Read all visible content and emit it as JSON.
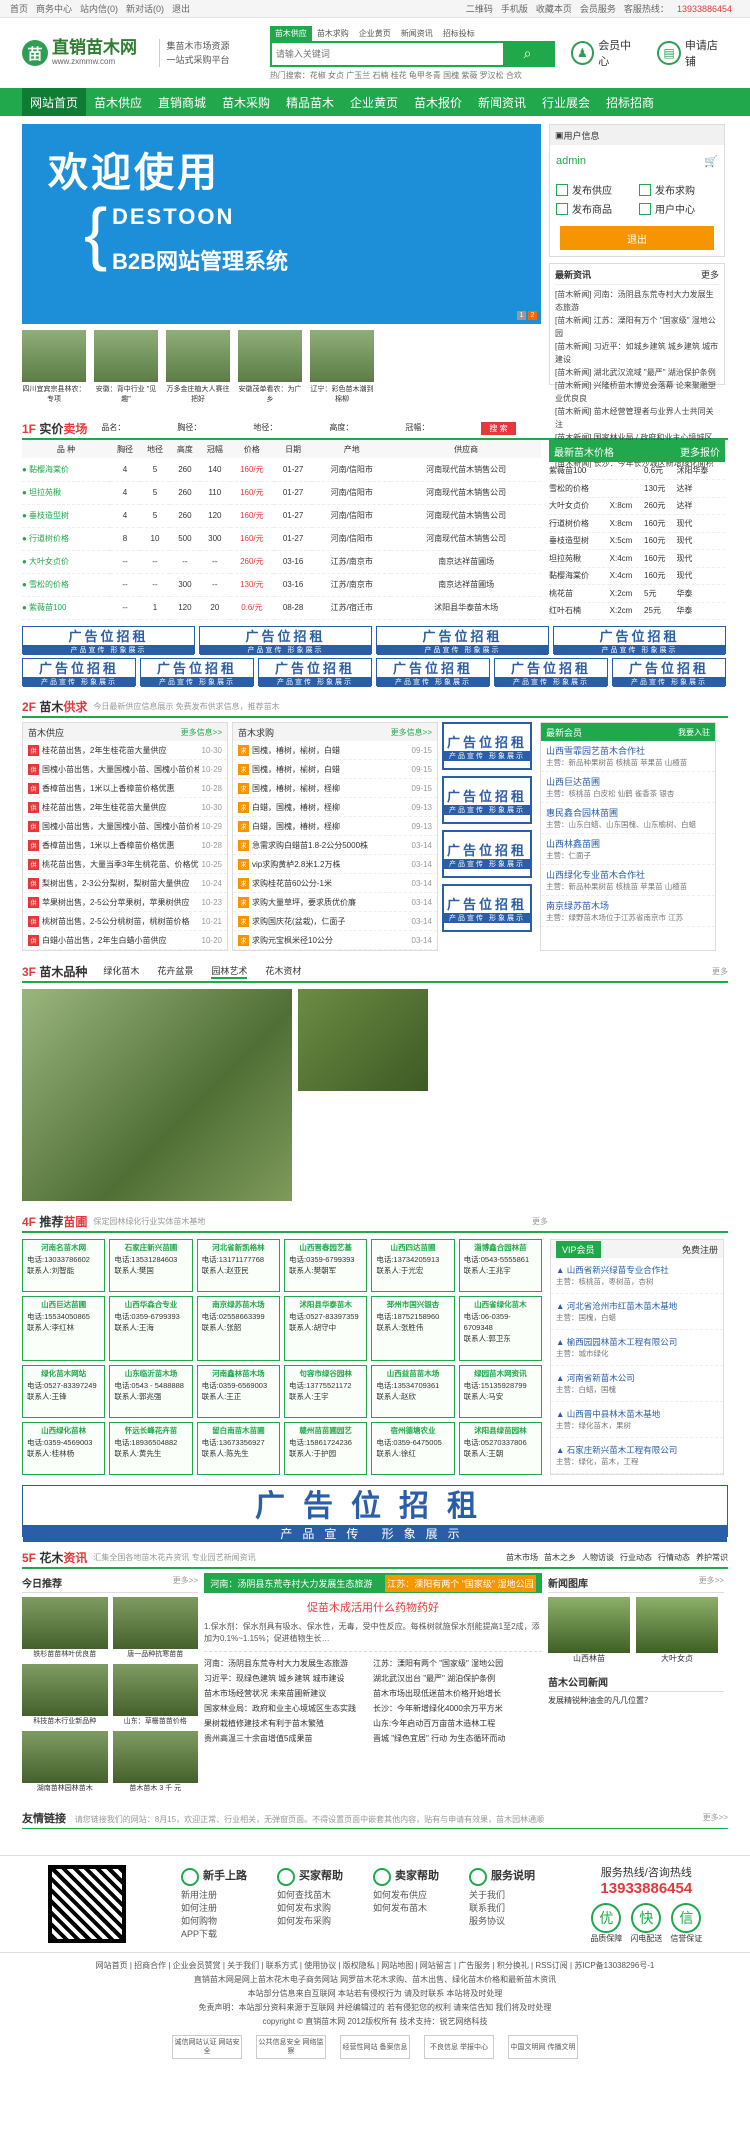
{
  "topbar": {
    "left": [
      "首页",
      "商务中心",
      "站内信(0)",
      "新对话(0)",
      "退出"
    ],
    "right": [
      "二维码",
      "手机版",
      "收藏本页",
      "会员服务",
      "客服热线：",
      "13933886454"
    ]
  },
  "header": {
    "logo": "直销苗木网",
    "url": "www.zxmmw.com",
    "slogan1": "集苗木市场资源",
    "slogan2": "一站式采购平台",
    "tabs": [
      "苗木供应",
      "苗木求购",
      "企业黄页",
      "新闻资讯",
      "招标投标"
    ],
    "search_placeholder": "请输入关键词",
    "hot": "热门搜索：花椒 女贞 广玉兰 石楠 桂花 龟甲冬青 国槐 紫薇 罗汉松 合欢",
    "member": "会员中心",
    "apply": "申请店铺"
  },
  "nav": [
    "网站首页",
    "苗木供应",
    "直销商城",
    "苗木采购",
    "精品苗木",
    "企业黄页",
    "苗木报价",
    "新闻资讯",
    "行业展会",
    "招标招商"
  ],
  "banner": {
    "h1": "欢迎使用",
    "h2": "DESTOON",
    "h3": "B2B网站管理系统",
    "pages": [
      "1",
      "2"
    ]
  },
  "user": {
    "header": "用户信息",
    "name": "admin",
    "ops": [
      "发布供应",
      "发布求购",
      "发布商品",
      "用户中心"
    ],
    "exit": "退出"
  },
  "latest": {
    "title": "最新资讯",
    "more": "更多",
    "items": [
      "[苗木新闻] 河南：汤阴县东荒寺村大力发展生态旅游",
      "[苗木新闻] 江苏：溧阳有万个 \"国家级\" 湿地公园",
      "[苗木新闻] 习近平：如城乡建筑 城乡建筑 城市建设",
      "[苗木新闻] 湖北武汉流域 \"最严\" 湖治保护条例",
      "[苗木新闻] 兴隆桥苗木博览会落幕 论来聚雕塑业优良良",
      "[苗木新闻] 苗木经营管理者与业界人士共同关注",
      "[苗木新闻] 国家林业局 / 政府和业主心境城区生态实践",
      "[苗木新闻] 长沙：今年长沙城区新增绿化面积"
    ]
  },
  "thumbs": [
    "四川宜宾宗县林农：专项",
    "安徽：背中行业 \"见趣\"",
    "万多金庄植大人赛往 把好",
    "安徽茂单看农：为广乡",
    "辽宁：彩色苗木潮到棉柳"
  ],
  "f1": {
    "num": "1F",
    "title": "实价",
    "title2": "卖场",
    "filters": [
      "品名：",
      "胸径：",
      "地径：",
      "高度：",
      "冠幅：",
      "搜 索"
    ],
    "cols": [
      "品 种",
      "胸径",
      "地径",
      "高度",
      "冠幅",
      "价格",
      "日期",
      "产地",
      "供应商"
    ],
    "rows": [
      [
        "黏樱海棠价",
        "4",
        "5",
        "260",
        "140",
        "160/元",
        "01-27",
        "河南/信阳市",
        "河南现代苗木销售公司"
      ],
      [
        "坦拉苑楸",
        "4",
        "5",
        "260",
        "110",
        "160/元",
        "01-27",
        "河南/信阳市",
        "河南现代苗木销售公司"
      ],
      [
        "垂枝造型树",
        "4",
        "5",
        "260",
        "120",
        "160/元",
        "01-27",
        "河南/信阳市",
        "河南现代苗木销售公司"
      ],
      [
        "行道树价格",
        "8",
        "10",
        "500",
        "300",
        "160/元",
        "01-27",
        "河南/信阳市",
        "河南现代苗木销售公司"
      ],
      [
        "大叶女贞价",
        "--",
        "--",
        "--",
        "--",
        "260/元",
        "03-16",
        "江苏/南京市",
        "南京达祥苗圃场"
      ],
      [
        "雪松的价格",
        "--",
        "--",
        "300",
        "--",
        "130/元",
        "03-16",
        "江苏/南京市",
        "南京达祥苗圃场"
      ],
      [
        "紫薇苗100",
        "--",
        "1",
        "120",
        "20",
        "0.6/元",
        "08-28",
        "江苏/宿迁市",
        "沭阳县华泰苗木场"
      ]
    ]
  },
  "price": {
    "title": "最新苗木价格",
    "more": "更多报价",
    "rows": [
      [
        "紫薇苗100",
        "",
        "0.6元",
        "沭阳华泰"
      ],
      [
        "雪松的价格",
        "",
        "130元",
        "达祥"
      ],
      [
        "大叶女贞价",
        "X:8cm",
        "260元",
        "达祥"
      ],
      [
        "行道树价格",
        "X:8cm",
        "160元",
        "现代"
      ],
      [
        "垂枝造型树",
        "X:5cm",
        "160元",
        "现代"
      ],
      [
        "坦拉苑楸",
        "X:4cm",
        "160元",
        "现代"
      ],
      [
        "黏樱海棠价",
        "X:4cm",
        "160元",
        "现代"
      ],
      [
        "桃花苗",
        "X:2cm",
        "5元",
        "华泰"
      ],
      [
        "红叶石楠",
        "X:2cm",
        "25元",
        "华泰"
      ]
    ]
  },
  "ad": {
    "a": "广告位招租",
    "b": "产品宣传 形象展示"
  },
  "f2": {
    "num": "2F",
    "title": "苗木",
    "title2": "供求",
    "sub": "今日最新供应信息展示 免费发布供求信息，推荐苗木",
    "supply": "苗木供应",
    "buy": "苗木求购",
    "more": "更多信息>>",
    "supply_items": [
      [
        "供",
        "桂花苗出售，2年生桂花苗大量供应",
        "10-30"
      ],
      [
        "供",
        "国槐小苗出售，大量国槐小苗、国槐小苗价格",
        "10-29"
      ],
      [
        "供",
        "香樟苗出售，1米以上香樟苗价格优惠",
        "10-28"
      ],
      [
        "供",
        "桂花苗出售，2年生桂花苗大量供应",
        "10-30"
      ],
      [
        "供",
        "国槐小苗出售，大量国槐小苗、国槐小苗价格",
        "10-29"
      ],
      [
        "供",
        "香樟苗出售，1米以上香樟苗价格优惠",
        "10-28"
      ],
      [
        "供",
        "桃花苗出售，大量当季3年生桃花苗、价格优惠",
        "10-25"
      ],
      [
        "供",
        "梨树出售，2-3公分梨树，梨树苗大量供应",
        "10-24"
      ],
      [
        "供",
        "苹果树出售，2-5公分苹果树，苹果树供应",
        "10-23"
      ],
      [
        "供",
        "桃树苗出售，2-5公分桃树苗，桃树苗价格",
        "10-21"
      ],
      [
        "供",
        "白蜡小苗出售，2年生白蜡小苗供应",
        "10-20"
      ]
    ],
    "buy_items": [
      [
        "求",
        "国槐，椿树，榆树，白蜡",
        "09-15"
      ],
      [
        "求",
        "国槐，椿树，榆树，白蜡",
        "09-15"
      ],
      [
        "求",
        "国槐，椿树，榆树，柽柳",
        "09-15"
      ],
      [
        "求",
        "白蜡，国槐，椿树，柽柳",
        "09-13"
      ],
      [
        "求",
        "白蜡，国槐，椿树，柽柳",
        "09-13"
      ],
      [
        "求",
        "急需求购白蜡苗1.8-2公分5000株",
        "03-14"
      ],
      [
        "求",
        "vip求购黄栌2.8米1.2万株",
        "03-14"
      ],
      [
        "求",
        "求购桂花苗60公分-1米",
        "03-14"
      ],
      [
        "求",
        "求购大量草坪，要求质优价廉",
        "03-14"
      ],
      [
        "求",
        "求购国庆花(盆栽)，仁面子",
        "03-14"
      ],
      [
        "求",
        "求购元宝枫米径10公分",
        "03-14"
      ]
    ],
    "co_title": "最新会员",
    "co_more": "我要入驻",
    "companies": [
      [
        "山西雪霏园艺苗木合作社",
        "主营：新品种果树苗 核桃苗 苹果苗 山楂苗"
      ],
      [
        "山西巨达苗圃",
        "主营：核桃苗 白皮松 仙鹤 雀香茶 银杏"
      ],
      [
        "惠民鑫合园林苗圃",
        "主营：山东白蜡、山东国槐、山东榆树、白蜡"
      ],
      [
        "山西林鑫苗圃",
        "主营：仁面子"
      ],
      [
        "山西绿化专业苗木合作社",
        "主营：新品种果树苗 核桃苗 苹果苗 山楂苗"
      ],
      [
        "南京绿苏苗木场",
        "主营：绿野苗木场位于江苏省南京市 江苏"
      ]
    ]
  },
  "f3": {
    "num": "3F",
    "title": "苗木品种",
    "tabs": [
      "绿化苗木",
      "花卉盆景",
      "园林艺术",
      "花木资材"
    ],
    "more": "更多"
  },
  "f4": {
    "num": "4F",
    "title": "推荐",
    "title2": "苗圃",
    "sub": "保定园林绿化行业实体苗木基地",
    "more": "更多",
    "vip": "VIP会员",
    "free": "免费注册",
    "cards": [
      [
        "河南名苗木网",
        "电话:13033786602",
        "联系人:刘智能"
      ],
      [
        "石家庄新兴苗圃",
        "电话:13531284603",
        "联系人:樊国"
      ],
      [
        "河北省新凯格林",
        "电话:13171177768",
        "联系人:赵亚民"
      ],
      [
        "山西晋春园艺基",
        "电话:0359-6799393",
        "联系人:樊朝军"
      ],
      [
        "山西四达苗圃",
        "电话:13734205913",
        "联系人:于光宏"
      ],
      [
        "淄博鑫合园林苗",
        "电话:0543-5555861",
        "联系人:王兆宇"
      ],
      [
        "山西巨达苗圃",
        "电话:15534050865",
        "联系人:李红林"
      ],
      [
        "山西华森合专业",
        "电话:0359-6799393",
        "联系人:王海"
      ],
      [
        "南京绿苏苗木场",
        "电话:02558663399",
        "联系人:张韶"
      ],
      [
        "沭阳县华泰苗木",
        "电话:0527-83397359",
        "联系人:胡守中"
      ],
      [
        "邳州市国兴银杏",
        "电话:18752158960",
        "联系人:张胜伟"
      ],
      [
        "山西省绿化苗木",
        "电话:06-0359-6709348",
        "联系人:郭卫东"
      ],
      [
        "绿化苗木网站",
        "电话:0527-83397249",
        "联系人:王锋"
      ],
      [
        "山东临沂苗木场",
        "电话:0543 - 5488888",
        "联系人:郭兆强"
      ],
      [
        "河南鑫林苗木场",
        "电话:0359-6569003",
        "联系人:王正"
      ],
      [
        "句容市绿谷园林",
        "电话:13775521172",
        "联系人:王宇"
      ],
      [
        "山西益苗苗木场",
        "电话:13534709361",
        "联系人:赵欣"
      ],
      [
        "绿园苗木网资讯",
        "电话:15135928799",
        "联系人:马安"
      ],
      [
        "山西绿化苗林",
        "电话:0359-4569003",
        "联系人:桂林杨"
      ],
      [
        "怀远长峰花卉苗",
        "电话:18936504882",
        "联系人:黄先生"
      ],
      [
        "留白南苗木苗圃",
        "电话:13673356927",
        "联系人:陈先生"
      ],
      [
        "赣州苗苗圃园艺",
        "电话:15861724236",
        "联系人:于护园"
      ],
      [
        "宿州德塘农业",
        "电话:0359-6475005",
        "联系人:徐红"
      ],
      [
        "沭阳县绿苗园林",
        "电话:05270337806",
        "联系人:王朝"
      ]
    ],
    "vips": [
      [
        "山西省新兴绿苗专业合作社",
        "主营：核桃苗，枣树苗，杏树"
      ],
      [
        "河北省沧州市红苗木苗木基地",
        "主营：国槐，白蜡"
      ],
      [
        "榆西园园林苗木工程有限公司",
        "主营：城市绿化"
      ],
      [
        "河南省新苗木公司",
        "主营：白蜡，国槐"
      ],
      [
        "山西晋中县林木苗木基地",
        "主营：绿化苗木，果树"
      ],
      [
        "石家庄新兴苗木工程有限公司",
        "主营：绿化，苗木，工程"
      ]
    ]
  },
  "f5": {
    "num": "5F",
    "title": "花木",
    "title2": "资讯",
    "sub": "汇集全国各地苗木花卉资讯 专业园艺新闻资讯",
    "tabs": [
      "苗木市场",
      "苗木之乡",
      "人物访谈",
      "行业动态",
      "行情动态",
      "养护常识"
    ],
    "today": "今日推荐",
    "more": "更多>>",
    "pics": [
      "铁杉苗苗林叶优良苗",
      "唐一品种抗寒苗苗",
      "科技苗木行业新品种",
      "山东：草栅苗苗价格",
      "湖南苗林园林苗木",
      "苗木苗木 3 千 元"
    ],
    "hl1": "河南：汤阴县东荒寺村大力发展生态旅游",
    "hl2": "江苏：溧阳有两个 \"国家级\" 湿地公园",
    "lead": "促苗木成活用什么药物药好",
    "lead_text": "1.保水剂：保水剂具有吸水、保水性，无毒，受中性反应。每株树就施保水剂能提高1至2成，添加为0.1%~1.15%；促进植物生长…",
    "news": [
      "河南：汤阴县东荒寺村大力发展生态旅游",
      "江苏：溧阳有两个 \"国家级\" 湿地公园",
      "习近平：现绿色建筑 城乡建筑 城市建设",
      "湖北武汉出台 \"最严\" 湖泊保护条例",
      "苗木市场经营状况 未来苗圃新建议",
      "苗木市场出现低迷苗木价格开始增长",
      "国家林业局：政府和业主心境城区生态实践",
      "长沙：今年新增绿化4000余万平方米",
      "果树栽植修建技术有利于苗木繁殖",
      "山东:今年启动百万亩苗木造林工程",
      "贵州高温三十余亩增值5成果苗",
      "晋城 \"绿色宜居\" 行动 为生态循环而动"
    ],
    "gallery": "新闻图库",
    "gal_items": [
      "山西林苗",
      "大叶女贞"
    ],
    "company_news": "苗木公司新闻",
    "cn_item": "发展精锐种油金的凡几位置？"
  },
  "friends": {
    "title": "友情链接",
    "sub": "请您链接我们的网站：8月15，欢迎正常、行业相关，无弹窗页面。不得设置页面中嵌套其他内容，贴有与申请有效果，苗木园林通顺",
    "more": "更多>>"
  },
  "footer": {
    "cols": [
      {
        "t": "新手上路",
        "items": [
          "新用注册",
          "如何注册",
          "如何购物",
          "APP下载"
        ]
      },
      {
        "t": "买家帮助",
        "items": [
          "如何查找苗木",
          "如何发布求购",
          "如何发布采购"
        ]
      },
      {
        "t": "卖家帮助",
        "items": [
          "如何发布供应",
          "如何发布苗木"
        ]
      },
      {
        "t": "服务说明",
        "items": [
          "关于我们",
          "联系我们",
          "服务协议"
        ]
      }
    ],
    "hotline_t": "服务热线/咨询热线",
    "hotline": "13933886454",
    "pledges": [
      "优",
      "快",
      "信"
    ],
    "pledge_sub": [
      "品质保障",
      "闪电配送",
      "信誉保证"
    ]
  },
  "copy": {
    "links": "网站首页 | 招商合作 | 企业会员赞赏 | 关于我们 | 联系方式 | 使用协议 | 版权隐私 | 网站地图 | 网站留言 | 广告服务 | 积分换礼 | RSS订阅 | 苏ICP备13038296号-1",
    "l2": "直销苗木网是网上苗木花木电子商务网站 网罗苗木花木求购、苗木出售、绿化苗木价格和最新苗木资讯",
    "l3": "本站部分信息来自互联网 本站若有侵权行为 请及时联系 本站将及时处理",
    "l4": "免责声明：本站部分资料来源于互联网 并经编辑过的 若有侵犯您的权利 请来信告知 我们将及时处理",
    "l5": "copyright © 直销苗木网 2012版权所有 技术支持：锐艺网络科技",
    "badges": [
      "诚信网站认证 网站安全",
      "公共信息安全 网络监察",
      "经营性网站 备案信息",
      "不良信息 举报中心",
      "中国文明网 传播文明"
    ]
  },
  "colors": {
    "green": "#21a84c",
    "red": "#e4393c",
    "blue": "#2a5ea8",
    "orange": "#f59500"
  }
}
